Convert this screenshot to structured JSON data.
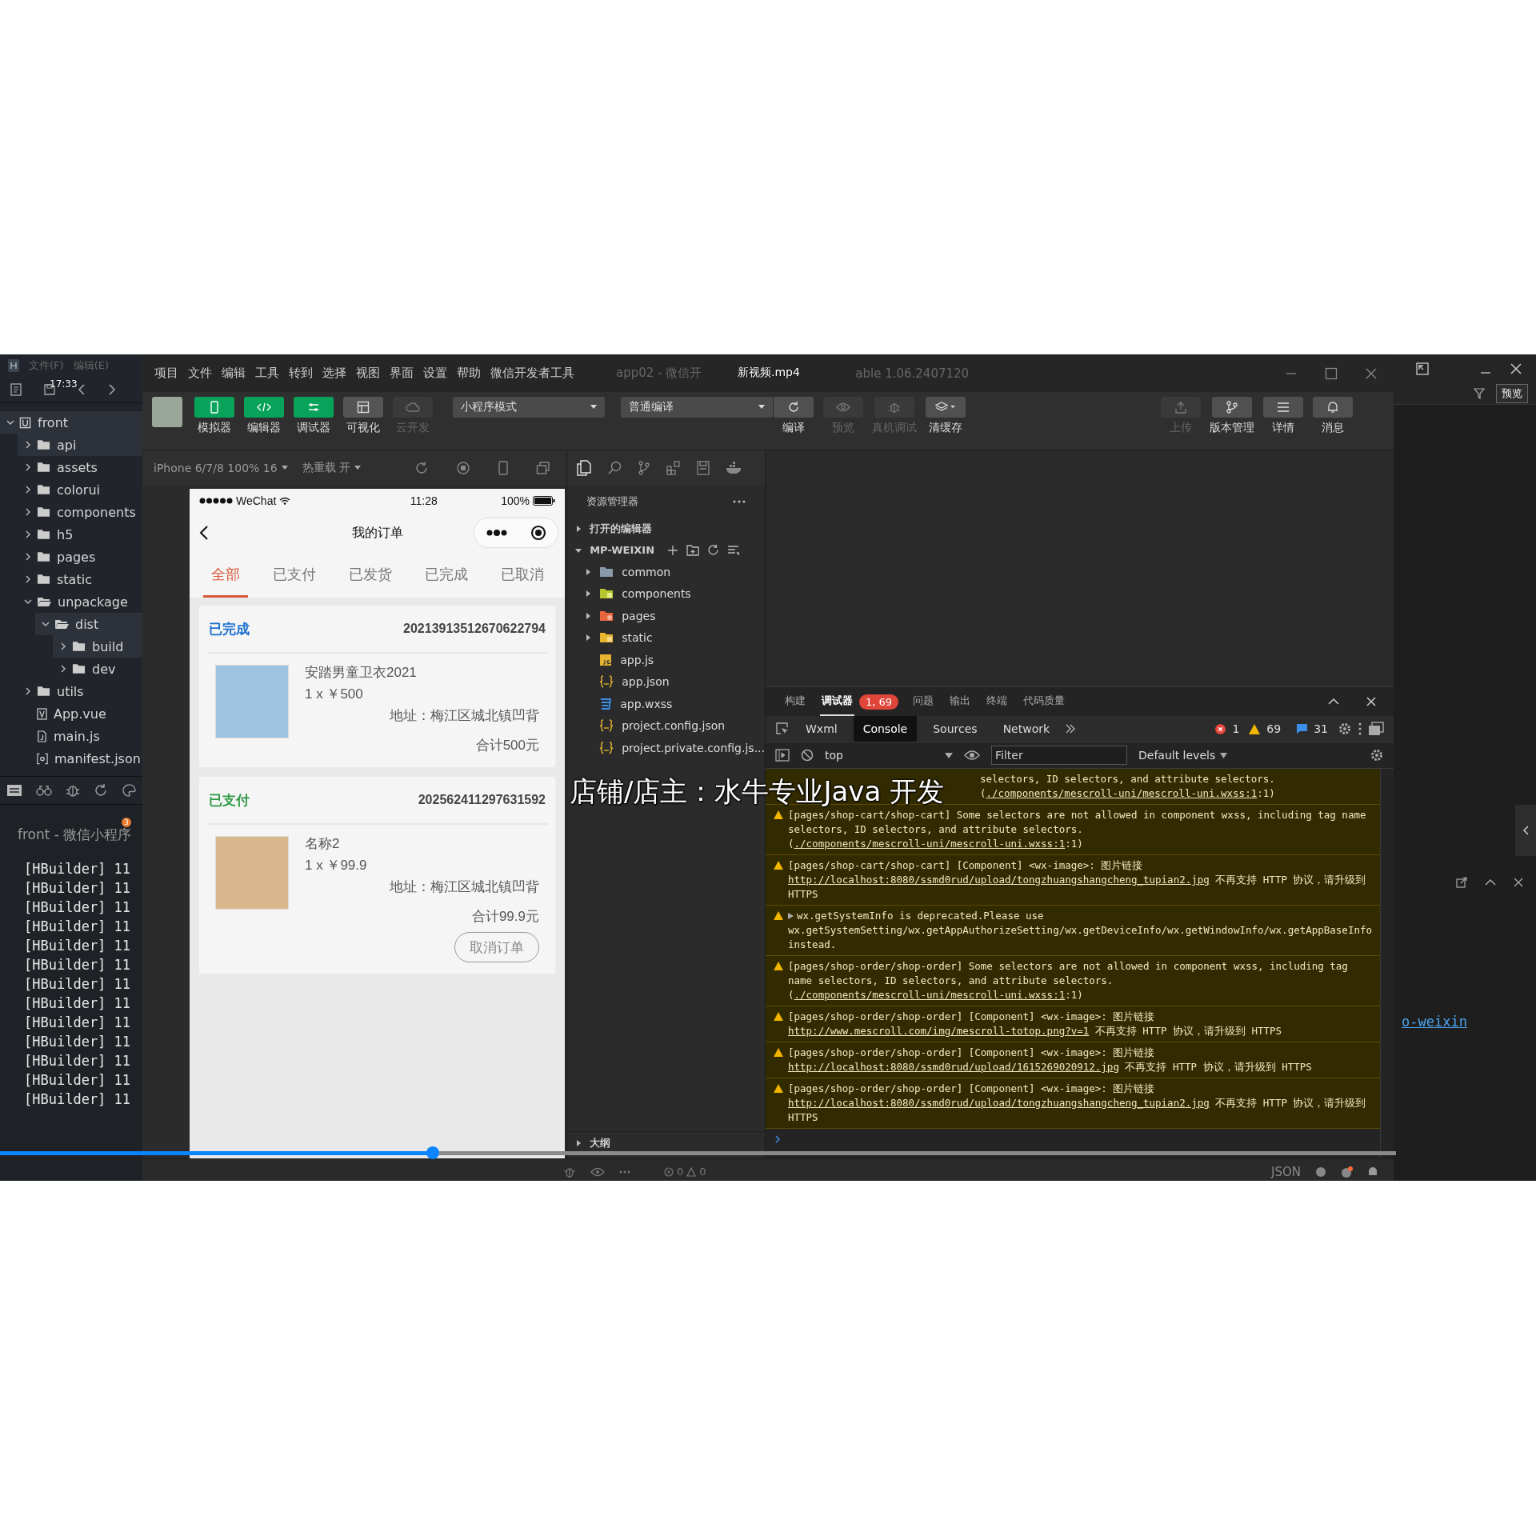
{
  "video_overlay": {
    "clock": "17:33",
    "file_name": "新视频.mp4",
    "subtitle": "店铺/店主：水牛专业Java 开发",
    "progress": {
      "level": 0.31
    }
  },
  "hbuilder": {
    "menu": [
      "文件(F)",
      "编辑(E)"
    ],
    "project_tree": [
      {
        "label": "front",
        "kind": "project",
        "expanded": true,
        "children": [
          {
            "label": "api",
            "kind": "folder",
            "expanded": false
          },
          {
            "label": "assets",
            "kind": "folder",
            "expanded": false
          },
          {
            "label": "colorui",
            "kind": "folder",
            "expanded": false
          },
          {
            "label": "components",
            "kind": "folder",
            "expanded": false
          },
          {
            "label": "h5",
            "kind": "folder",
            "expanded": false
          },
          {
            "label": "pages",
            "kind": "folder",
            "expanded": false
          },
          {
            "label": "static",
            "kind": "folder",
            "expanded": false
          },
          {
            "label": "unpackage",
            "kind": "folder",
            "expanded": true,
            "children": [
              {
                "label": "dist",
                "kind": "folder",
                "expanded": true,
                "children": [
                  {
                    "label": "build",
                    "kind": "folder",
                    "expanded": false
                  },
                  {
                    "label": "dev",
                    "kind": "folder",
                    "expanded": false
                  }
                ]
              }
            ]
          },
          {
            "label": "utils",
            "kind": "folder",
            "expanded": false
          },
          {
            "label": "App.vue",
            "kind": "vue"
          },
          {
            "label": "main.js",
            "kind": "file"
          },
          {
            "label": "manifest.json",
            "kind": "config"
          }
        ]
      }
    ],
    "console": {
      "title": "front - 微信小程序",
      "badge": "3",
      "lines": [
        "[HBuilder] 11",
        "[HBuilder] 11",
        "[HBuilder] 11",
        "[HBuilder] 11",
        "[HBuilder] 11",
        "[HBuilder] 11",
        "[HBuilder] 11",
        "[HBuilder] 11",
        "[HBuilder] 11",
        "[HBuilder] 11",
        "[HBuilder] 11",
        "[HBuilder] 11",
        "[HBuilder] 11"
      ]
    },
    "right_panel": {
      "button": "预览",
      "link": "o-weixin"
    }
  },
  "devtools": {
    "menu": [
      "项目",
      "文件",
      "编辑",
      "工具",
      "转到",
      "选择",
      "视图",
      "界面",
      "设置",
      "帮助",
      "微信开发者工具"
    ],
    "title_left": "app02 - 微信开",
    "title_right": "able 1.06.2407120",
    "view_buttons": [
      {
        "label": "模拟器",
        "kind": "simulator",
        "selected": true,
        "disabled": false
      },
      {
        "label": "编辑器",
        "kind": "editor",
        "selected": true,
        "disabled": false
      },
      {
        "label": "调试器",
        "kind": "debugger",
        "selected": true,
        "disabled": false
      },
      {
        "label": "可视化",
        "kind": "visual",
        "selected": false,
        "disabled": false
      },
      {
        "label": "云开发",
        "kind": "cloud",
        "selected": false,
        "disabled": true
      }
    ],
    "mode_select": "小程序模式",
    "compile_select": "普通编译",
    "compile_buttons": [
      {
        "label": "编译",
        "kind": "refresh",
        "disabled": false
      },
      {
        "label": "预览",
        "kind": "eye",
        "disabled": true
      },
      {
        "label": "真机调试",
        "kind": "bug",
        "disabled": true
      },
      {
        "label": "清缓存",
        "kind": "layers",
        "disabled": false
      }
    ],
    "right_buttons": [
      {
        "label": "上传",
        "kind": "upload",
        "disabled": true
      },
      {
        "label": "版本管理",
        "kind": "branch",
        "disabled": false
      },
      {
        "label": "详情",
        "kind": "menu",
        "disabled": false
      },
      {
        "label": "消息",
        "kind": "bell",
        "disabled": false
      }
    ],
    "simulator": {
      "device": "iPhone 6/7/8 100% 16",
      "hot_reload": "热重载 开",
      "phone": {
        "carrier": "WeChat",
        "time": "11:28",
        "battery": "100%",
        "title": "我的订单",
        "tabs": [
          {
            "label": "全部",
            "selected": true
          },
          {
            "label": "已支付",
            "selected": false
          },
          {
            "label": "已发货",
            "selected": false
          },
          {
            "label": "已完成",
            "selected": false
          },
          {
            "label": "已取消",
            "selected": false
          }
        ],
        "orders": [
          {
            "status": "已完成",
            "color": "#1a6fd0",
            "order_no": "20213913512670622794",
            "product": "安踏男童卫衣2021",
            "quantity_price": "1 x ￥500",
            "address": "地址：梅江区城北镇凹背",
            "total": "合计500元"
          },
          {
            "status": "已支付",
            "color": "#2f9a44",
            "order_no": "202562411297631592",
            "product": "名称2",
            "quantity_price": "1 x ￥99.9",
            "address": "地址：梅江区城北镇凹背",
            "total": "合计99.9元",
            "action": "取消订单"
          }
        ]
      }
    },
    "explorer": {
      "title": "资源管理器",
      "sections": [
        {
          "label": "打开的编辑器",
          "expanded": false
        },
        {
          "label": "MP-WEIXIN",
          "expanded": true
        }
      ],
      "files": [
        {
          "label": "common",
          "kind": "folder",
          "expanded": false
        },
        {
          "label": "components",
          "kind": "folder-components",
          "expanded": false
        },
        {
          "label": "pages",
          "kind": "folder-pages",
          "expanded": false
        },
        {
          "label": "static",
          "kind": "folder-static",
          "expanded": false
        },
        {
          "label": "app.js",
          "kind": "js"
        },
        {
          "label": "app.json",
          "kind": "json"
        },
        {
          "label": "app.wxss",
          "kind": "wxss"
        },
        {
          "label": "project.config.json",
          "kind": "json"
        },
        {
          "label": "project.private.config.js...",
          "kind": "json"
        }
      ],
      "outline": {
        "label": "大纲",
        "expanded": false
      }
    },
    "panel": {
      "tabs": [
        {
          "label": "构建",
          "selected": false
        },
        {
          "label": "调试器",
          "selected": true,
          "badge": "1, 69"
        },
        {
          "label": "问题",
          "selected": false
        },
        {
          "label": "输出",
          "selected": false
        },
        {
          "label": "终端",
          "selected": false
        },
        {
          "label": "代码质量",
          "selected": false
        }
      ],
      "devtools_tabs": [
        {
          "label": "Wxml",
          "selected": false
        },
        {
          "label": "Console",
          "selected": true
        },
        {
          "label": "Sources",
          "selected": false
        },
        {
          "label": "Network",
          "selected": false
        }
      ],
      "counts": {
        "errors": "1",
        "warnings": "69",
        "info": "31"
      },
      "context": "top",
      "filter_placeholder": "Filter",
      "levels": "Default levels",
      "messages": [
        {
          "kind": "continuation",
          "parts": [
            {
              "kind": "text",
              "text": "selectors, ID selectors, and attribute selectors.("
            },
            {
              "kind": "link",
              "text": "./components/mescroll-uni/mescroll-uni.wxss:1"
            },
            {
              "kind": "text",
              "text": ":1)"
            }
          ]
        },
        {
          "kind": "warning",
          "parts": [
            {
              "kind": "text",
              "text": "[pages/shop-cart/shop-cart] Some selectors are not allowed in component wxss, including tag name selectors, ID selectors, and attribute selectors.("
            },
            {
              "kind": "link",
              "text": "./components/mescroll-uni/mescroll-uni.wxss:1"
            },
            {
              "kind": "text",
              "text": ":1)"
            }
          ]
        },
        {
          "kind": "warning",
          "parts": [
            {
              "kind": "text",
              "text": "[pages/shop-cart/shop-cart] [Component] <wx-image>: 图片链接 "
            },
            {
              "kind": "link",
              "text": "http://localhost:8080/ssmd0rud/upload/tongzhuangshangcheng_tupian2.jpg"
            },
            {
              "kind": "text",
              "text": " 不再支持 HTTP 协议，请升级到 HTTPS"
            }
          ]
        },
        {
          "kind": "warning-group",
          "parts": [
            {
              "kind": "text",
              "text": "wx.getSystemInfo is deprecated.Please use wx.getSystemSetting/wx.getAppAuthorizeSetting/wx.getDeviceInfo/wx.getWindowInfo/wx.getAppBaseInfo instead."
            }
          ]
        },
        {
          "kind": "warning",
          "parts": [
            {
              "kind": "text",
              "text": "[pages/shop-order/shop-order] Some selectors are not allowed in component wxss, including tag name selectors, ID selectors, and attribute selectors.("
            },
            {
              "kind": "link",
              "text": "./components/mescroll-uni/mescroll-uni.wxss:1"
            },
            {
              "kind": "text",
              "text": ":1)"
            }
          ]
        },
        {
          "kind": "warning",
          "parts": [
            {
              "kind": "text",
              "text": "[pages/shop-order/shop-order] [Component] <wx-image>: 图片链接 "
            },
            {
              "kind": "link",
              "text": "http://www.mescroll.com/img/mescroll-totop.png?v=1"
            },
            {
              "kind": "text",
              "text": " 不再支持 HTTP 协议，请升级到 HTTPS"
            }
          ]
        },
        {
          "kind": "warning",
          "parts": [
            {
              "kind": "text",
              "text": "[pages/shop-order/shop-order] [Component] <wx-image>: 图片链接 "
            },
            {
              "kind": "link",
              "text": "http://localhost:8080/ssmd0rud/upload/1615269020912.jpg"
            },
            {
              "kind": "text",
              "text": " 不再支持 HTTP 协议，请升级到 HTTPS"
            }
          ]
        },
        {
          "kind": "warning",
          "parts": [
            {
              "kind": "text",
              "text": "[pages/shop-order/shop-order] [Component] <wx-image>: 图片链接 "
            },
            {
              "kind": "link",
              "text": "http://localhost:8080/ssmd0rud/upload/tongzhuangshangcheng_tupian2.jpg"
            },
            {
              "kind": "text",
              "text": " 不再支持 HTTP 协议，请升级到 HTTPS"
            }
          ]
        }
      ]
    },
    "status_bar": {
      "errors": "0",
      "warnings": "0",
      "language": "JSON"
    }
  }
}
